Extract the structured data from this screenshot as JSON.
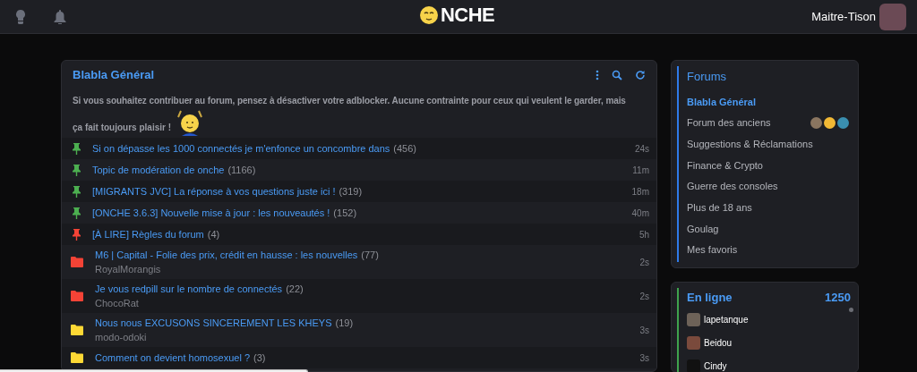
{
  "header": {
    "logo": "NCHE",
    "username": "Maitre-Tison"
  },
  "board": {
    "title": "Blabla Général",
    "notice": [
      "Si vous souhaitez contribuer au forum, pensez à désactiver votre adblocker. Aucune contrainte pour ceux qui veulent le garder, mais",
      "ça fait toujours plaisir !"
    ],
    "topics": [
      {
        "kind": "pin",
        "color": "#4caf50",
        "title": "Si on dépasse les 1000 connectés je m'enfonce un concombre dans",
        "count": "(456)",
        "time": "24s"
      },
      {
        "kind": "pin",
        "color": "#4caf50",
        "title": "Topic de modération de onche",
        "count": "(1166)",
        "time": "11m"
      },
      {
        "kind": "pin",
        "color": "#4caf50",
        "title": "[MIGRANTS JVC] La réponse à vos questions juste ici !",
        "count": "(319)",
        "time": "18m"
      },
      {
        "kind": "pin",
        "color": "#4caf50",
        "title": "[ONCHE 3.6.3] Nouvelle mise à jour : les nouveautés !",
        "count": "(152)",
        "time": "40m"
      },
      {
        "kind": "pin",
        "color": "#f44336",
        "title": "[À LIRE] Règles du forum",
        "count": "(4)",
        "time": "5h"
      },
      {
        "kind": "folder",
        "color": "#f44336",
        "title": "M6 | Capital - Folie des prix, crédit en hausse : les nouvelles",
        "count": "(77)",
        "author": "RoyalMorangis",
        "time": "2s"
      },
      {
        "kind": "folder",
        "color": "#f44336",
        "title": "Je vous redpill sur le nombre de connectés",
        "count": "(22)",
        "author": "ChocoRat",
        "time": "2s"
      },
      {
        "kind": "folder",
        "color": "#fdd835",
        "title": "Nous nous EXCUSONS SINCEREMENT LES KHEYS",
        "count": "(19)",
        "author": "modo-odoki",
        "time": "3s"
      },
      {
        "kind": "folder",
        "color": "#fdd835",
        "title": "Comment on devient homosexuel ?",
        "count": "(3)",
        "time": "3s"
      }
    ]
  },
  "forums": {
    "title": "Forums",
    "items": [
      {
        "label": "Blabla Général",
        "selected": true
      },
      {
        "label": "Forum des anciens",
        "selected": false,
        "avatars": [
          {
            "color": "#8a7560"
          },
          {
            "color": "#f2b935"
          },
          {
            "color": "#3a8fb0"
          }
        ]
      },
      {
        "label": "Suggestions & Réclamations",
        "selected": false
      },
      {
        "label": "Finance & Crypto",
        "selected": false
      },
      {
        "label": "Guerre des consoles",
        "selected": false
      },
      {
        "label": "Plus de 18 ans",
        "selected": false
      },
      {
        "label": "Goulag",
        "selected": false
      },
      {
        "label": "Mes favoris",
        "selected": false
      }
    ]
  },
  "online": {
    "title": "En ligne",
    "count": "1250",
    "users": [
      "lapetanque",
      "Beidou",
      "Cindy"
    ]
  }
}
